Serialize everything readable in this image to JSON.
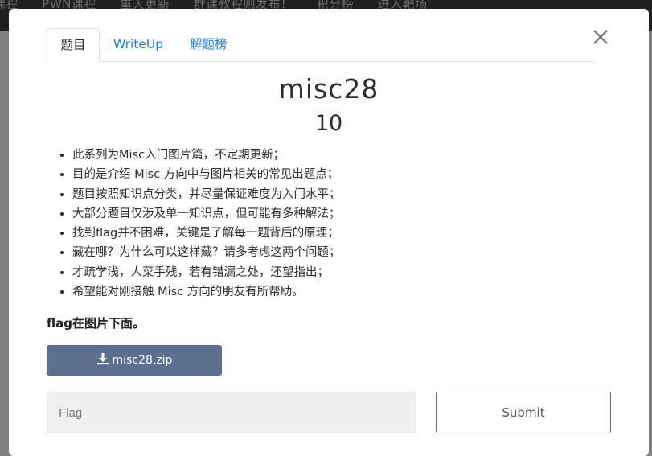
{
  "topbar": {
    "links": [
      "课程",
      "PWN课程",
      "重大更新",
      "群课教程则发布！",
      "积分榜",
      "进入靶场"
    ]
  },
  "tabs": [
    {
      "label": "题目"
    },
    {
      "label": "WriteUp"
    },
    {
      "label": "解题榜"
    }
  ],
  "challenge": {
    "name": "misc28",
    "points": "10",
    "description": [
      "此系列为Misc入门图片篇，不定期更新；",
      "目的是介绍 Misc 方向中与图片相关的常见出题点；",
      "题目按照知识点分类，并尽量保证难度为入门水平；",
      "大部分题目仅涉及单一知识点，但可能有多种解法；",
      "找到flag并不困难，关键是了解每一题背后的原理；",
      "藏在哪？为什么可以这样藏？请多考虑这两个问题；",
      "才疏学浅，人菜手残，若有错漏之处，还望指出；",
      "希望能对刚接触 Misc 方向的朋友有所帮助。"
    ],
    "note": "flag在图片下面。",
    "file": "misc28.zip"
  },
  "form": {
    "flag_placeholder": "Flag",
    "flag_value": "",
    "submit_label": "Submit"
  },
  "icons": {
    "close": "close-icon",
    "download": "download-icon"
  },
  "colors": {
    "tab_link": "#1e7be6",
    "download_button": "#5b708e",
    "overlay": "#7f7f7f"
  }
}
